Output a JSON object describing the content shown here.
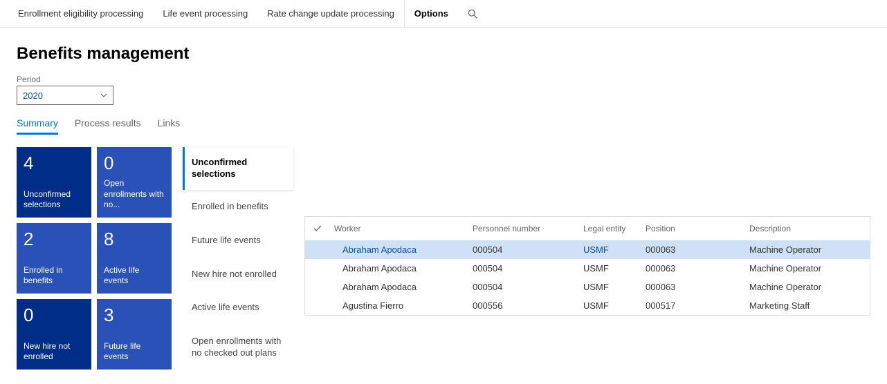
{
  "toolbar": {
    "items": [
      "Enrollment eligibility processing",
      "Life event processing",
      "Rate change update processing"
    ],
    "options": "Options"
  },
  "page_title": "Benefits management",
  "period": {
    "label": "Period",
    "value": "2020"
  },
  "tabs": [
    {
      "label": "Summary",
      "active": true
    },
    {
      "label": "Process results",
      "active": false
    },
    {
      "label": "Links",
      "active": false
    }
  ],
  "tiles": [
    {
      "count": "4",
      "label": "Unconfirmed selections",
      "style": "active"
    },
    {
      "count": "0",
      "label": "Open enrollments with no...",
      "style": "normal"
    },
    {
      "count": "2",
      "label": "Enrolled in benefits",
      "style": "normal"
    },
    {
      "count": "8",
      "label": "Active life events",
      "style": "normal"
    },
    {
      "count": "0",
      "label": "New hire not enrolled",
      "style": "active"
    },
    {
      "count": "3",
      "label": "Future life events",
      "style": "normal"
    }
  ],
  "categories": [
    {
      "label": "Unconfirmed selections",
      "selected": true
    },
    {
      "label": "Enrolled in benefits",
      "selected": false
    },
    {
      "label": "Future life events",
      "selected": false
    },
    {
      "label": "New hire not enrolled",
      "selected": false
    },
    {
      "label": "Active life events",
      "selected": false
    },
    {
      "label": "Open enrollments with no checked out plans",
      "selected": false
    }
  ],
  "table": {
    "columns": [
      "Worker",
      "Personnel number",
      "Legal entity",
      "Position",
      "Description"
    ],
    "rows": [
      {
        "worker": "Abraham Apodaca",
        "personnel": "000504",
        "legal": "USMF",
        "position": "000063",
        "description": "Machine Operator",
        "selected": true
      },
      {
        "worker": "Abraham Apodaca",
        "personnel": "000504",
        "legal": "USMF",
        "position": "000063",
        "description": "Machine Operator",
        "selected": false
      },
      {
        "worker": "Abraham Apodaca",
        "personnel": "000504",
        "legal": "USMF",
        "position": "000063",
        "description": "Machine Operator",
        "selected": false
      },
      {
        "worker": "Agustina Fierro",
        "personnel": "000556",
        "legal": "USMF",
        "position": "000517",
        "description": "Marketing Staff",
        "selected": false
      }
    ]
  }
}
